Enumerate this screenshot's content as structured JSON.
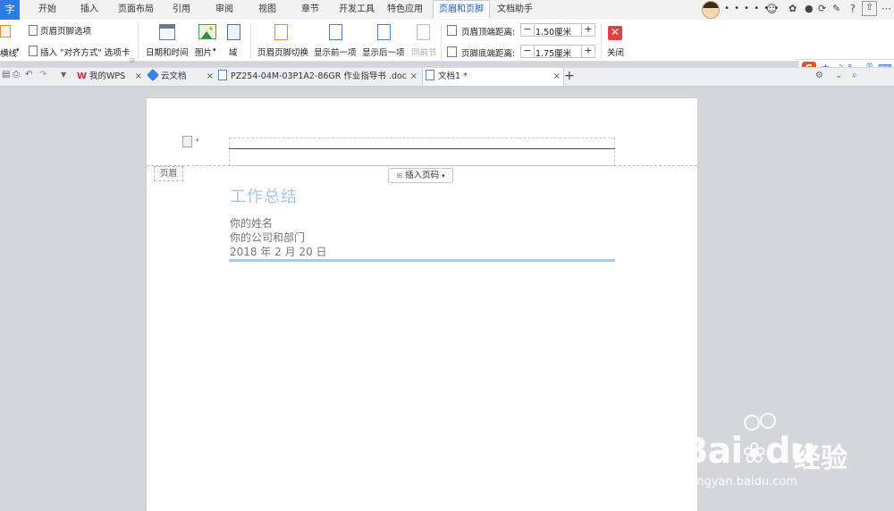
{
  "menubar": {
    "app_button": "字",
    "tabs": [
      "开始",
      "插入",
      "页面布局",
      "引用",
      "审阅",
      "视图",
      "章节",
      "开发工具",
      "特色应用",
      "页眉和页脚",
      "文档助手"
    ],
    "active_tab": "页眉和页脚",
    "user_name": "• • • • • •",
    "help": "?"
  },
  "ribbon": {
    "header_line": "横线",
    "header_footer_options": "页眉页脚选项",
    "insert_align_tab": "插入 \"对齐方式\" 选项卡",
    "date_time": "日期和时间",
    "picture": "图片",
    "field": "域",
    "switch_header_footer": "页眉页脚切换",
    "show_previous": "显示前一项",
    "show_next": "显示后一项",
    "same_as_previous": "同前节",
    "header_top_distance_label": "页眉顶端距离:",
    "header_top_distance_value": "1.50厘米",
    "footer_bottom_distance_label": "页脚底端距离:",
    "footer_bottom_distance_value": "1.75厘米",
    "close": "关闭"
  },
  "ime": {
    "logo": "S",
    "mode": "中"
  },
  "doc_tabs": [
    {
      "label": "我的WPS",
      "logo": "W"
    },
    {
      "label": "云文档"
    },
    {
      "label": "PZ254-04M-03P1A2-86GR 作业指导书 .doc"
    },
    {
      "label": "文档1 *"
    }
  ],
  "document": {
    "header_label": "页眉",
    "insert_page_number": "插入页码",
    "title": "工作总结",
    "name": "你的姓名",
    "company": "你的公司和部门",
    "date": "2018 年 2 月 20 日"
  },
  "watermark": {
    "brand": "Bai",
    "brand2": "du",
    "jingyan": "经验",
    "url": "jingyan.baidu.com"
  },
  "colors": {
    "accent": "#2f7ae5",
    "title_color": "#a9c4e8",
    "rule_color": "#aac8ec",
    "close_red": "#e04040"
  }
}
